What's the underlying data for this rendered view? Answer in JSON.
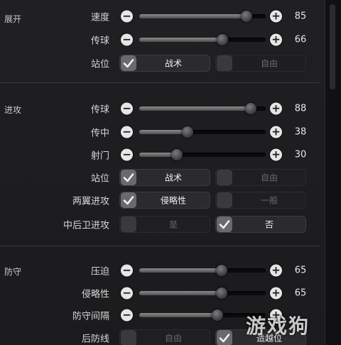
{
  "sections": {
    "zhankai": "展开",
    "jingong": "进攻",
    "fangshou": "防守"
  },
  "rows": {
    "sudu": {
      "label": "速度",
      "value": "85",
      "level": 0.85
    },
    "chuanqiu1": {
      "label": "传球",
      "value": "66",
      "level": 0.66
    },
    "zhanwei1": {
      "label": "站位",
      "opt_a": "战术",
      "opt_b": "自由",
      "selected": "opt_a"
    },
    "chuanqiu2": {
      "label": "传球",
      "value": "88",
      "level": 0.88
    },
    "chuanzhong": {
      "label": "传中",
      "value": "38",
      "level": 0.38
    },
    "shemen": {
      "label": "射门",
      "value": "30",
      "level": 0.3
    },
    "zhanwei2": {
      "label": "站位",
      "opt_a": "战术",
      "opt_b": "自由",
      "selected": "opt_a"
    },
    "liangyi": {
      "label": "两翼进攻",
      "opt_a": "侵略性",
      "opt_b": "一般",
      "selected": "opt_a"
    },
    "zhonghouwei": {
      "label": "中后卫进攻",
      "opt_a": "是",
      "opt_b": "否",
      "selected": "opt_b"
    },
    "yapo": {
      "label": "压迫",
      "value": "65",
      "level": 0.65
    },
    "qinlvexing": {
      "label": "侵略性",
      "value": "65",
      "level": 0.65
    },
    "fangshoujiange": {
      "label": "防守间隔",
      "value": "",
      "level": 0.62
    },
    "houfangxian": {
      "label": "后防线",
      "opt_a": "自由",
      "opt_b": "造越位",
      "selected": "opt_b"
    }
  },
  "controls": {
    "minus": "−",
    "plus": "+"
  },
  "watermark": "游戏狗",
  "colors": {
    "background": "#1c1c1e",
    "knob": "#5a5a5e",
    "button": "#e6e6e6"
  }
}
